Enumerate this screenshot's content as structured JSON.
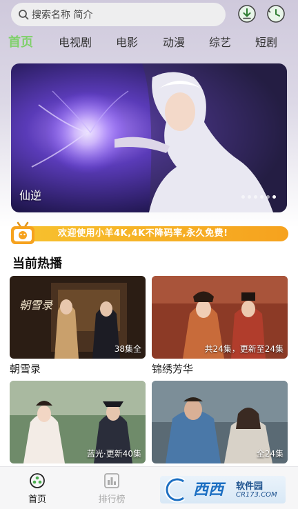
{
  "search": {
    "placeholder": "搜索名称 简介"
  },
  "tabs": [
    {
      "label": "首页",
      "active": true
    },
    {
      "label": "电视剧",
      "active": false
    },
    {
      "label": "电影",
      "active": false
    },
    {
      "label": "动漫",
      "active": false
    },
    {
      "label": "综艺",
      "active": false
    },
    {
      "label": "短剧",
      "active": false
    }
  ],
  "banner": {
    "title": "仙逆",
    "dot_count": 6,
    "active_dot": 5
  },
  "notice": {
    "text": "欢迎使用小羊4K,4K不降码率,永久免费!"
  },
  "section": {
    "title": "当前热播"
  },
  "cards": [
    {
      "title": "朝雪录",
      "episodes": "38集全"
    },
    {
      "title": "锦绣芳华",
      "episodes": "共24集，更新至24集"
    },
    {
      "title": "",
      "episodes": "蓝光·更新40集"
    },
    {
      "title": "",
      "episodes": "全24集"
    }
  ],
  "bottom_nav": [
    {
      "label": "首页",
      "active": true
    },
    {
      "label": "排行榜",
      "active": false
    }
  ],
  "watermark": {
    "brand": "西西",
    "sub": "软件园",
    "url": "CR173.COM"
  },
  "colors": {
    "accent": "#7fd06a",
    "notice": "#f6a21e",
    "icon_green": "#4caf50"
  }
}
